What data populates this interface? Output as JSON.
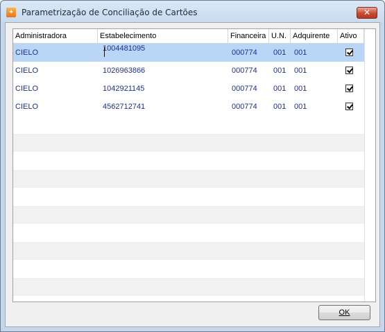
{
  "window": {
    "title": "Parametrização de Conciliação de Cartões",
    "close_label": "✕"
  },
  "grid": {
    "columns": [
      "Administradora",
      "Estabelecimento",
      "Financeira",
      "U.N.",
      "Adquirente",
      "Ativo"
    ],
    "rows": [
      {
        "administradora": "CIELO",
        "estabelecimento": "1004481095",
        "financeira": "000774",
        "un": "001",
        "adquirente": "001",
        "ativo": true
      },
      {
        "administradora": "CIELO",
        "estabelecimento": "1026963866",
        "financeira": "000774",
        "un": "001",
        "adquirente": "001",
        "ativo": true
      },
      {
        "administradora": "CIELO",
        "estabelecimento": "1042921145",
        "financeira": "000774",
        "un": "001",
        "adquirente": "001",
        "ativo": true
      },
      {
        "administradora": "CIELO",
        "estabelecimento": "4562712741",
        "financeira": "000774",
        "un": "001",
        "adquirente": "001",
        "ativo": true
      }
    ],
    "selected_row": 0
  },
  "footer": {
    "ok_label": "OK"
  },
  "colors": {
    "selected_row": "#b9d6f7",
    "cell_text": "#1a2f98",
    "alt_row": "#f1f1f1"
  }
}
